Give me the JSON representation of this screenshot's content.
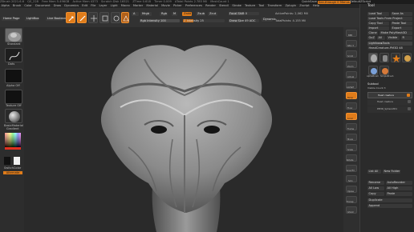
{
  "titlebar": {
    "left": "ZBrush 2021.6.6",
    "project": "QS_228",
    "mem": "Free Mem 5.496GB",
    "active_mem": "Active Mem 4373",
    "scratch": "Scratch Disk 16521",
    "ztime": "ZTime 0.618",
    "timer": "Timer 0.009",
    "poly": "ATotal Points 2.785 Mil",
    "mesh": "MeshCount 1",
    "quicksave": "QuickSave",
    "see_through": "See-through 0",
    "menus": "Menus",
    "default_script": "DefaultZScript"
  },
  "menu": [
    "Alpha",
    "Brush",
    "Color",
    "Document",
    "Draw",
    "Dynamics",
    "Edit",
    "File",
    "Layer",
    "Light",
    "Macro",
    "Marker",
    "Material",
    "Movie",
    "Picker",
    "Preferences",
    "Render",
    "Stencil",
    "Stroke",
    "Texture",
    "Tool",
    "Transform",
    "Zplugin",
    "Zscript",
    "Help"
  ],
  "shelf": {
    "home_page": "Home Page",
    "lightbox": "LightBox",
    "live_boolean": "Live Boolean",
    "edit": "Edit",
    "draw": "Draw",
    "move": "Move",
    "scale": "Scale",
    "rotate": "Rotate"
  },
  "controls": {
    "mrgb": "Mrgb",
    "rgb": "Rgb",
    "m": "M",
    "rgb_intensity": "Rgb Intensity 100",
    "zadd": "Zadd",
    "zsub": "Zsub",
    "zcut": "Zcut",
    "z_intensity": "Z Intensity 25",
    "focal_shift": "Focal Shift 0",
    "draw_size": "Draw Size 49 ADC",
    "dynamic": "Dynamic",
    "active_points": "ActivePoints: 2,062 Mil",
    "total_points": "TotalPoints: 4.155 Mil"
  },
  "left": {
    "standard": "Standard",
    "dots": "Dots",
    "alpha_off": "Alpha Off",
    "texture_off": "Texture Off",
    "basic_material": "BasicMaterial",
    "gradient": "Gradient",
    "switch_color": "SwitchColor",
    "alternate": "Alternate"
  },
  "right_tools": [
    "BPR",
    "SPix 3",
    "Scroll",
    "Zoom",
    "Actual",
    "AAHalf",
    "Persp",
    "Floor",
    "Local",
    "Frame",
    "Move",
    "Scale",
    "Rotate",
    "Line Fill",
    "Solo",
    "Xpose",
    "Transp",
    "Ghost"
  ],
  "tool": {
    "title": "Tool",
    "load_tool": "Load Tool",
    "save_as": "Save As",
    "load_from_project": "Load Tools From Project",
    "copy_tool": "Copy Tool",
    "paste_tool": "Paste Tool",
    "import": "Import",
    "export": "Export",
    "clone": "Clone",
    "make_polymesh": "Make PolyMesh3D",
    "goz": "GoZ",
    "all": "All",
    "visible": "Visible",
    "r": "R",
    "lightbox_tools": "Lightbox▸Tools",
    "current_tool": "HeadCreature-PM3D 48",
    "subtool_title": "Subtool",
    "visible_count": "Visible Count 3",
    "st1": "Head creature",
    "st2": "Head creature",
    "st3": "PM3D_Sphere3D1",
    "list_all": "List All",
    "new_folder": "New Folder",
    "rename": "Rename",
    "auto_reorder": "AutoReorder",
    "all_low": "All Low",
    "all_high": "All High",
    "copy": "Copy",
    "paste": "Paste",
    "duplicate": "Duplicate",
    "append": "Append",
    "thumb1": "AlphaBrush",
    "thumb2": "SimpleBrush",
    "thumb3": "EraserBrush",
    "thumb4": "Cylinder3D"
  },
  "colors": {
    "accent": "#e07c1a",
    "bg": "#2a2a2a"
  }
}
